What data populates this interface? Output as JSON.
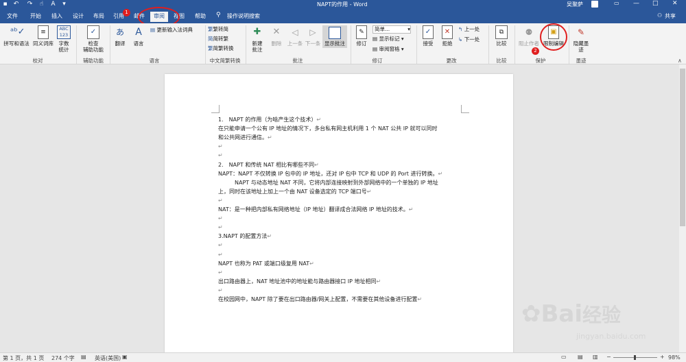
{
  "window": {
    "title": "NAPT的作用 - Word",
    "user": "吴聚萨"
  },
  "qat": {
    "save_icon": "save-icon",
    "undo_icon": "undo-icon",
    "redo_icon": "redo-icon",
    "touch_icon": "touch-mode-icon",
    "font_icon": "font-color-icon",
    "more_icon": "customize-qat-icon"
  },
  "tabs": [
    {
      "label": "文件"
    },
    {
      "label": "开始"
    },
    {
      "label": "插入"
    },
    {
      "label": "设计"
    },
    {
      "label": "布局"
    },
    {
      "label": "引用"
    },
    {
      "label": "邮件"
    },
    {
      "label": "审阅"
    },
    {
      "label": "视图"
    },
    {
      "label": "帮助"
    }
  ],
  "tell_me": "操作说明搜索",
  "share": "共享",
  "annotations": {
    "step1": "1",
    "step2": "2"
  },
  "ribbon": {
    "proofing": {
      "spelling": "拼写和语法",
      "thesaurus": "同义词库",
      "word_count_line1": "字数",
      "word_count_line2": "统计",
      "wordcount_icon_text": "ABC\n123",
      "group": "校对"
    },
    "accessibility": {
      "check_line1": "检查",
      "check_line2": "辅助功能",
      "group": "辅助功能"
    },
    "language": {
      "translate": "翻译",
      "language": "语言",
      "update_ime": "更新输入法词典",
      "group": "语言"
    },
    "chinese": {
      "trad_to_simp": "繁转简",
      "simp_to_trad": "简转繁",
      "convert": "简繁转换",
      "group": "中文简繁转换"
    },
    "comments": {
      "new_line1": "新建",
      "new_line2": "批注",
      "delete": "删除",
      "prev": "上一条",
      "next": "下一条",
      "show": "显示批注",
      "group": "批注"
    },
    "tracking": {
      "track": "修订",
      "markup_mode": "简单...",
      "show_markup": "显示标记",
      "pane": "审阅窗格",
      "group": "修订"
    },
    "changes": {
      "accept": "接受",
      "reject": "拒绝",
      "prev": "上一处",
      "next": "下一处",
      "group": "更改"
    },
    "compare": {
      "compare": "比较",
      "group": "比较"
    },
    "protect": {
      "block": "阻止作者",
      "restrict": "限制编辑",
      "group": "保护"
    },
    "ink": {
      "hide_line1": "隐藏墨",
      "hide_line2": "迹",
      "group": "墨迹"
    }
  },
  "document": {
    "lines": [
      {
        "text": "1.　NAPT 的作用（为啥产生这个技术）",
        "mark": "↵"
      },
      {
        "text": "在只能申请一个公有 IP 地址的情况下，多台私有网主机利用 1 个 NAT 公共 IP 就可以同时",
        "mark": ""
      },
      {
        "text": "和公共网进行通信。",
        "mark": "↵"
      },
      {
        "text": "",
        "mark": "↵"
      },
      {
        "text": "",
        "mark": "↵"
      },
      {
        "text": "2.　NAPT 和传统 NAT 相比有哪些不同",
        "mark": "↵"
      },
      {
        "text": "NAPT：NAPT 不仅转换 IP 包中的 IP 地址，还对 IP 包中 TCP 和 UDP 的 Port 进行转换。",
        "mark": "↵"
      },
      {
        "text": "　　　NAPT 与动态地址 NAT 不同，它将内部连接映射到外部网络中的一个单独的 IP 地址",
        "mark": ""
      },
      {
        "text": "上，同时在该地址上加上一个由 NAT 设备选定的 TCP 端口号",
        "mark": "↵"
      },
      {
        "text": "",
        "mark": "↵"
      },
      {
        "text": "NAT：是一种把内部私有网络地址（IP 地址）翻译成合法网络 IP 地址的技术。",
        "mark": "↵"
      },
      {
        "text": "",
        "mark": "↵"
      },
      {
        "text": "",
        "mark": "↵"
      },
      {
        "text": "3.NAPT 的配置方法",
        "mark": "↵"
      },
      {
        "text": "",
        "mark": "↵"
      },
      {
        "text": "",
        "mark": "↵"
      },
      {
        "text": "NAPT 也称为 PAT 或端口级复用 NAT",
        "mark": "↵"
      },
      {
        "text": "",
        "mark": "↵"
      },
      {
        "text": "出口路由器上，NAT 地址池中的地址能与路由器接口 IP 地址相同",
        "mark": "↵"
      },
      {
        "text": "",
        "mark": "↵"
      },
      {
        "text": "在校园网中，NAPT 除了要在出口路由器/网关上配置，不需要在其他设备进行配置",
        "mark": "↵"
      }
    ]
  },
  "status": {
    "page": "第 1 页，共 1 页",
    "words": "274 个字",
    "lang": "英语(美国)",
    "zoom": "98%",
    "zoom_level": 0.98
  },
  "watermark": {
    "brand": "Bai",
    "brand_suffix": "经验",
    "url": "jingyan.baidu.com"
  },
  "colors": {
    "accent": "#2b579a",
    "annotation": "#e01e1e"
  }
}
